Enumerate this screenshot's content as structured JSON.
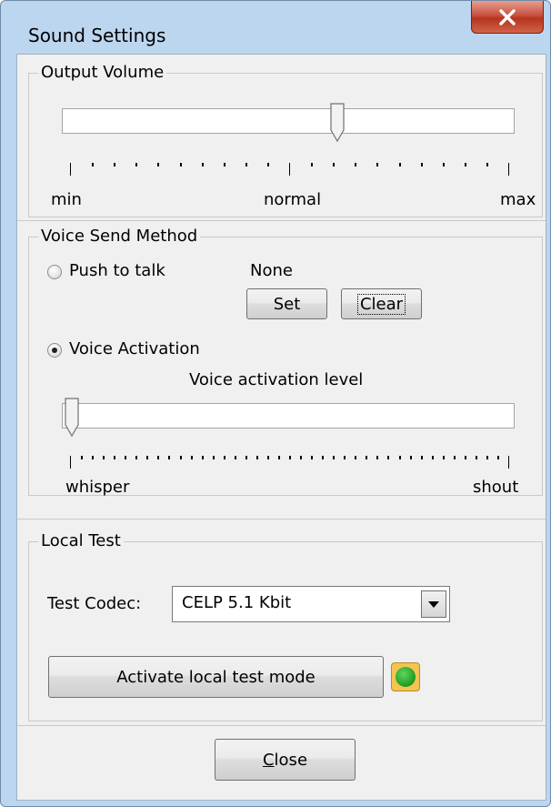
{
  "window": {
    "title": "Sound Settings",
    "close_icon": "close-x-icon"
  },
  "output_volume": {
    "legend": "Output Volume",
    "value_fraction": 0.61,
    "labels": {
      "min": "min",
      "mid": "normal",
      "max": "max"
    }
  },
  "voice_send": {
    "legend": "Voice Send Method",
    "push_to_talk": {
      "label": "Push to talk",
      "selected": false,
      "hotkey": "None"
    },
    "set_label": "Set",
    "clear_label": "Clear",
    "voice_activation": {
      "label": "Voice Activation",
      "selected": true
    },
    "level_label": "Voice activation level",
    "level_fraction": 0.0,
    "labels": {
      "min": "whisper",
      "max": "shout"
    }
  },
  "local_test": {
    "legend": "Local Test",
    "codec_label": "Test Codec:",
    "codec_value": "CELP 5.1 Kbit",
    "activate_label": "Activate local test mode",
    "indicator_color": "#2bb52b"
  },
  "footer": {
    "close_label": "Close"
  },
  "colors": {
    "frame": "#bcd6ef",
    "client": "#f0f0f0",
    "close_button": "#c8513f"
  }
}
